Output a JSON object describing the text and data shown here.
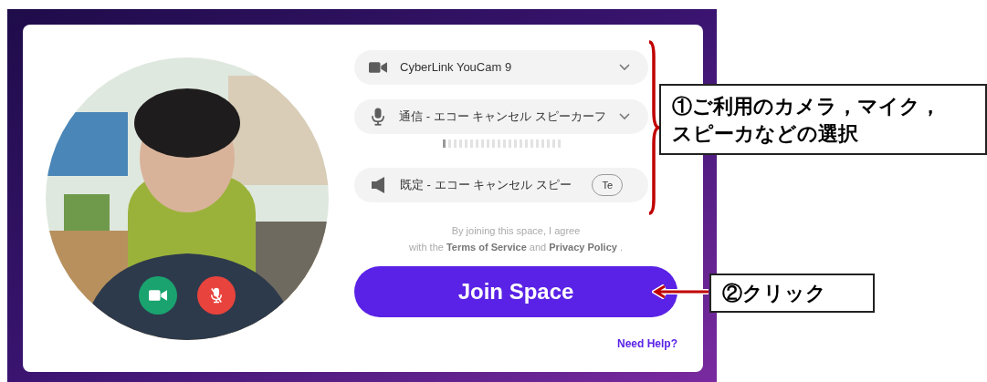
{
  "preview": {
    "kind": "picture",
    "camera_on": true,
    "mic_muted": true
  },
  "devices": [
    {
      "kind": "camera",
      "label": "CyberLink YouCam 9"
    },
    {
      "kind": "microphone",
      "label": "通信 - エコー キャンセル スピーカーフ",
      "meter": {
        "level": 0.05
      }
    },
    {
      "kind": "speaker",
      "label": "既定 - エコー キャンセル スピー",
      "test_button": "Te"
    }
  ],
  "consent": "By joining this space, I agree\nwith the **Terms of Service** and **Privacy Policy** .",
  "join_button": "Join Space",
  "help_link": "Need Help?",
  "callouts": [
    {
      "kind": "bracket",
      "lines": [
        "①ご利用のカメラ，マイク，",
        "スピーカなどの選択"
      ]
    },
    {
      "kind": "arrow",
      "lines": [
        "②クリック"
      ]
    }
  ]
}
